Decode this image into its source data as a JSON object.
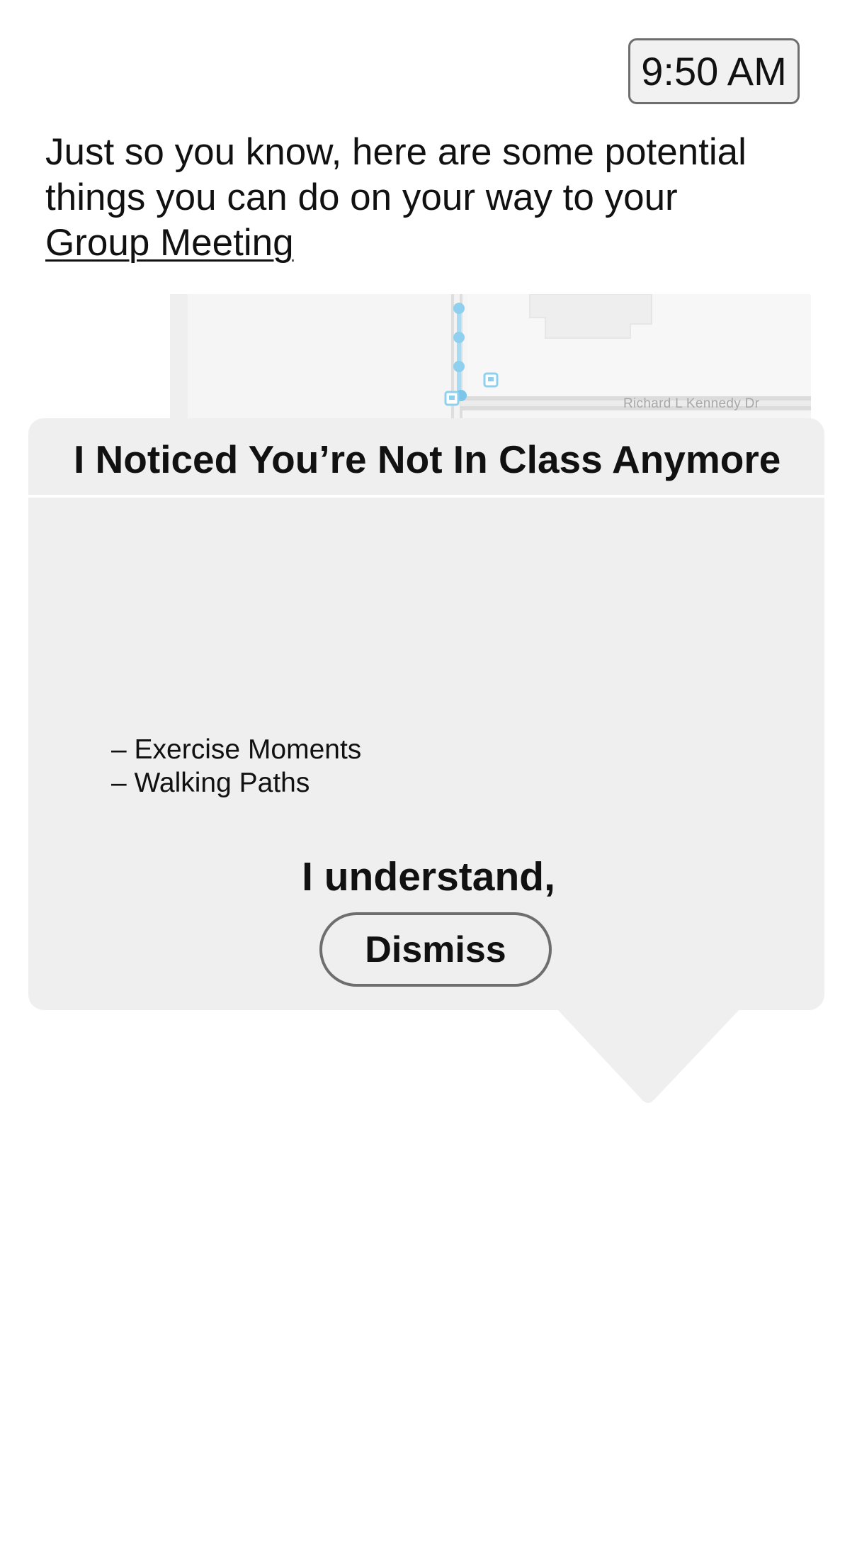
{
  "status": {
    "time": "9:50 AM"
  },
  "map": {
    "street_name": "Richard L Kennedy Dr",
    "route_color": "#8fd0ee",
    "road_color": "#dcdcdc",
    "background_color": "#f5f5f5",
    "icons": [
      "bus-stop-icon",
      "bus-stop-icon"
    ]
  },
  "popup": {
    "title": "I Noticed You’re Not In Class Anymore",
    "message_prefix": "Just so you know, here are some potential things you can do on your way to your ",
    "meeting_link": "Group Meeting",
    "suggestions": [
      "– Exercise Moments",
      "– Walking Paths"
    ],
    "acknowledge_text": "I understand,",
    "dismiss_label": "Dismiss",
    "background_color": "#efefef"
  }
}
